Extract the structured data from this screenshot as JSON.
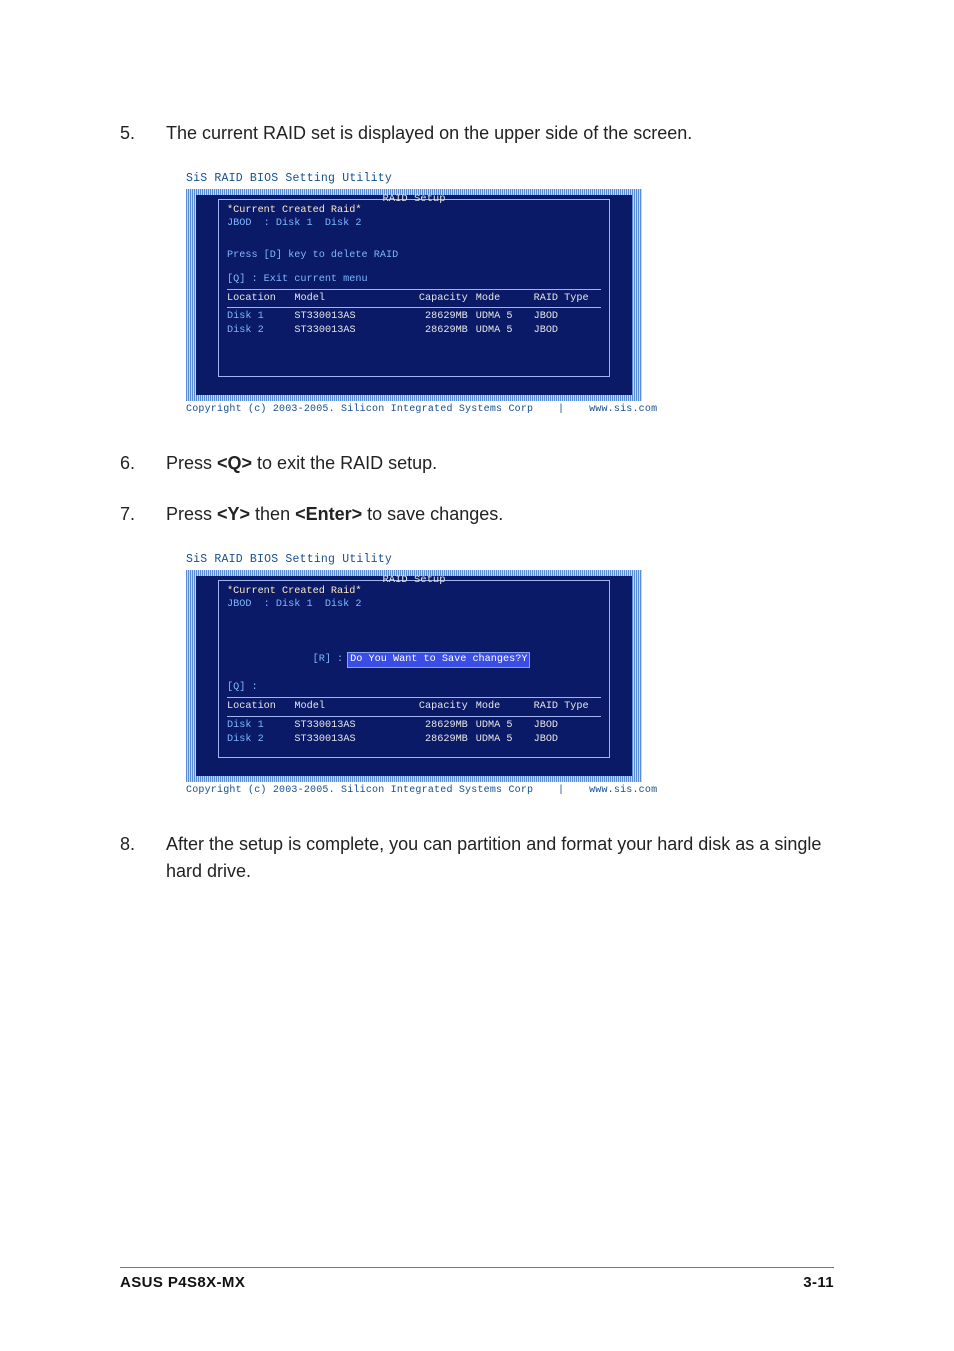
{
  "steps": {
    "s5": {
      "num": "5.",
      "text": "The current RAID set is displayed on the upper side of the screen."
    },
    "s6": {
      "num": "6.",
      "prefix": "Press ",
      "key1": "<Q>",
      "suffix": " to exit the RAID setup."
    },
    "s7": {
      "num": "7.",
      "prefix": "Press ",
      "key1": "<Y>",
      "mid": " then ",
      "key2": "<Enter>",
      "suffix": " to save changes."
    },
    "s8": {
      "num": "8.",
      "text": "After the setup is complete, you can partition and format your hard disk as a single hard drive."
    }
  },
  "bios": {
    "title": "SiS RAID BIOS Setting Utility",
    "section": "RAID Setup",
    "currentRaidLabel": "*Current Created Raid*",
    "jbodLine": "JBOD  : Disk 1  Disk 2",
    "deleteHint": "Press [D] key to delete RAID",
    "exitHint": "[Q] : Exit current menu",
    "r_key": "[R] :",
    "q_key": "[Q] :",
    "savePrompt": "Do You Want to Save changes?Y",
    "cols": {
      "loc": "Location",
      "model": "Model",
      "cap": "Capacity",
      "mode": "Mode",
      "type": "RAID Type"
    },
    "rows": [
      {
        "loc": "Disk 1",
        "model": "ST330013AS",
        "cap": "28629MB",
        "mode": "UDMA 5",
        "type": "JBOD"
      },
      {
        "loc": "Disk 2",
        "model": "ST330013AS",
        "cap": "28629MB",
        "mode": "UDMA 5",
        "type": "JBOD"
      }
    ],
    "footer": "Copyright (c) 2003-2005. Silicon Integrated Systems Corp    |    www.sis.com"
  },
  "footer": {
    "left": "ASUS P4S8X-MX",
    "right": "3-11"
  }
}
